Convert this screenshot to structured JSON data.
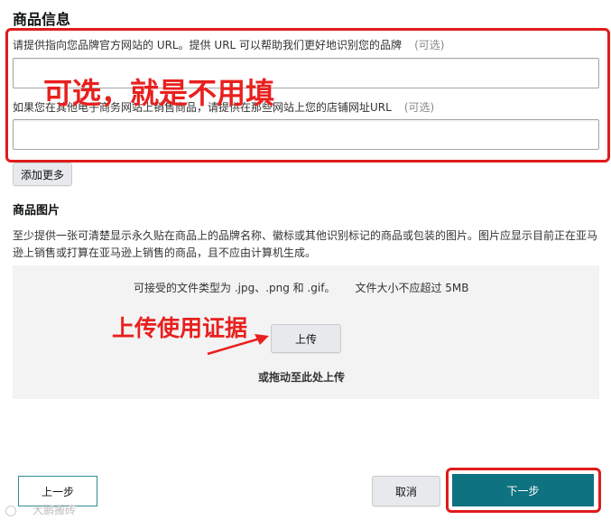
{
  "brand_info": {
    "title": "商品信息",
    "website_label": "请提供指向您品牌官方网站的 URL。提供 URL 可以帮助我们更好地识别您的品牌",
    "optional_tag": "(可选)",
    "website_value": "",
    "store_label": "如果您在其他电子商务网站上销售商品，请提供在那些网站上您的店铺网址URL",
    "store_value": "",
    "add_more": "添加更多"
  },
  "images": {
    "title": "商品图片",
    "description": "至少提供一张可清楚显示永久贴在商品上的品牌名称、徽标或其他识别标记的商品或包装的图片。图片应显示目前正在亚马逊上销售或打算在亚马逊上销售的商品，且不应由计算机生成。",
    "file_types": "可接受的文件类型为 .jpg、.png 和 .gif。",
    "file_size": "文件大小不应超过 5MB",
    "upload_button": "上传",
    "drag_hint": "或拖动至此处上传"
  },
  "annotations": {
    "optional_note": "可选，就是不用填",
    "upload_note": "上传使用证据",
    "color": "#e01b1b"
  },
  "footer": {
    "prev": "上一步",
    "cancel": "取消",
    "next": "下一步"
  },
  "watermark": "大鹏搬砖",
  "colors": {
    "primary": "#0f7281",
    "annotation_red": "#e01b1b",
    "upload_bg": "#f3f3f3"
  }
}
